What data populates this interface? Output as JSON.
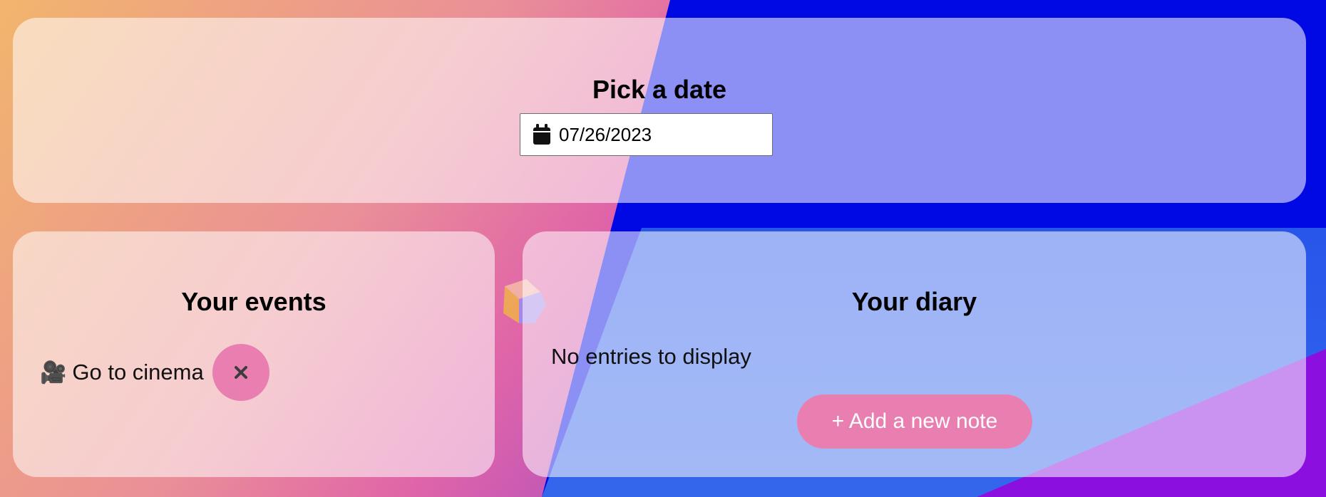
{
  "date_picker": {
    "title": "Pick a date",
    "value": "07/26/2023",
    "icon": "calendar-icon"
  },
  "events": {
    "title": "Your events",
    "items": [
      {
        "emoji": "🎥",
        "label": "Go to cinema",
        "delete_icon": "close-icon"
      }
    ]
  },
  "diary": {
    "title": "Your diary",
    "empty_text": "No entries to display",
    "add_button_label": "+ Add a new note"
  },
  "colors": {
    "accent_pink": "#e97fb0",
    "background_blue": "#0008e4",
    "card_overlay": "rgba(255,255,255,0.55)"
  }
}
